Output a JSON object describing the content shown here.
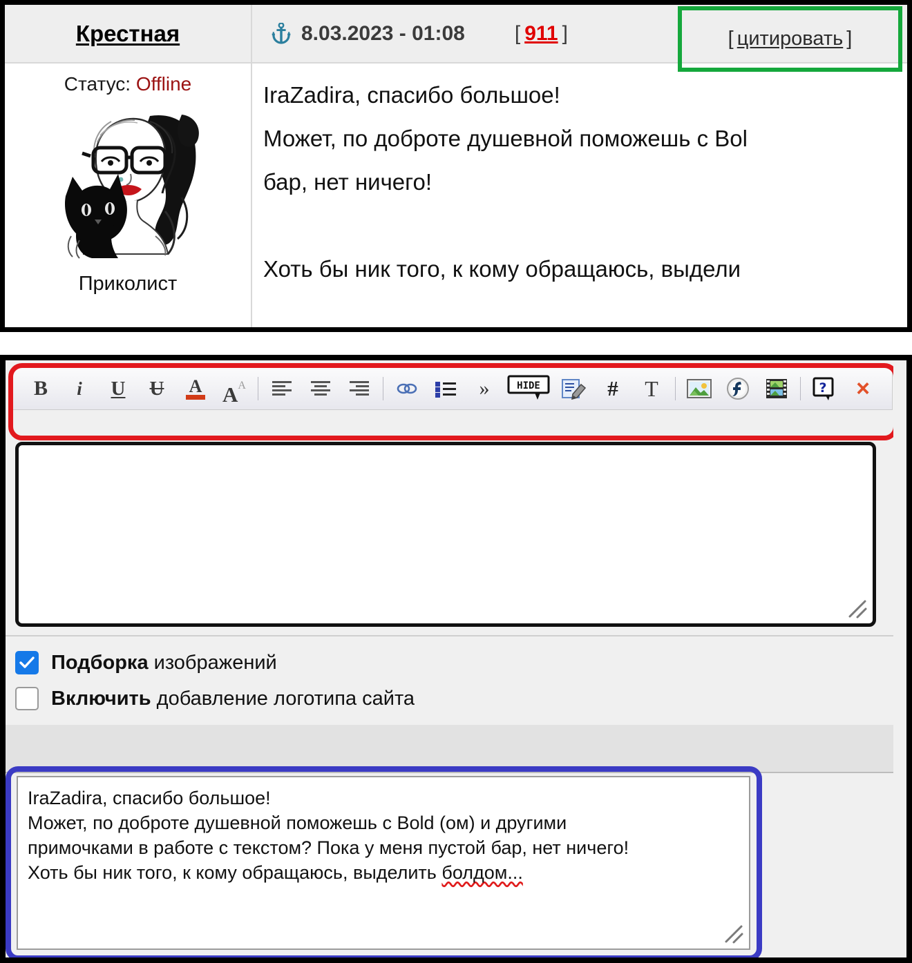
{
  "post": {
    "author": "Крестная",
    "anchor_icon": "anchor-icon",
    "date": "8.03.2023 - 01:08",
    "bracket_open": "[",
    "bracket_close": "]",
    "post_number": "911",
    "quote_label": "цитировать",
    "status_label": "Статус:",
    "status_value": "Offline",
    "rank": "Приколист",
    "avatar_alt": "avatar-woman-with-black-cat",
    "body_lines": [
      "IraZadira, спасибо большое!",
      "Может, по доброте душевной поможешь с Bol",
      "бар, нет ничего!",
      "",
      "Хоть бы ник того, к кому обращаюсь, выдели"
    ]
  },
  "editor": {
    "toolbar": [
      {
        "name": "bold-icon",
        "glyph": "B",
        "title": "Bold"
      },
      {
        "name": "italic-icon",
        "glyph": "i",
        "title": "Italic"
      },
      {
        "name": "underline-icon",
        "glyph": "U",
        "title": "Underline"
      },
      {
        "name": "strikethrough-icon",
        "glyph": "U",
        "title": "Strikethrough"
      },
      {
        "name": "font-color-icon",
        "glyph": "A",
        "title": "Font color"
      },
      {
        "name": "font-size-icon",
        "glyph": "A",
        "title": "Font size"
      },
      {
        "name": "align-left-icon",
        "glyph": "",
        "title": "Align left"
      },
      {
        "name": "align-center-icon",
        "glyph": "",
        "title": "Align center"
      },
      {
        "name": "align-right-icon",
        "glyph": "",
        "title": "Align right"
      },
      {
        "name": "link-icon",
        "glyph": "",
        "title": "Insert link"
      },
      {
        "name": "bullet-list-icon",
        "glyph": "",
        "title": "Bulleted list"
      },
      {
        "name": "quote-icon",
        "glyph": "»",
        "title": "Quote"
      },
      {
        "name": "hide-tag-icon",
        "glyph": "HIDE",
        "title": "Hide tag"
      },
      {
        "name": "edit-note-icon",
        "glyph": "",
        "title": "Edit note"
      },
      {
        "name": "hash-icon",
        "glyph": "#",
        "title": "Code"
      },
      {
        "name": "text-icon",
        "glyph": "T",
        "title": "Plain text"
      },
      {
        "name": "image-icon",
        "glyph": "",
        "title": "Insert image"
      },
      {
        "name": "flash-icon",
        "glyph": "f",
        "title": "Insert flash"
      },
      {
        "name": "video-icon",
        "glyph": "",
        "title": "Insert video"
      },
      {
        "name": "help-icon",
        "glyph": "?",
        "title": "Help"
      },
      {
        "name": "close-icon",
        "glyph": "×",
        "title": "Close"
      }
    ],
    "message_value": "",
    "message_placeholder": "",
    "checkboxes": [
      {
        "name": "selection-of-images",
        "bold": "Подборка",
        "rest": " изображений",
        "checked": true
      },
      {
        "name": "include-site-logo",
        "bold": "Включить",
        "rest": " добавление логотипа сайта",
        "checked": false
      }
    ],
    "quote_lines": [
      "IraZadira, спасибо большое!",
      "Может, по доброте душевной поможешь с Bold (ом) и другими",
      "примочками в работе с текстом? Пока у меня пустой бар, нет ничего!",
      "Хоть бы ник того, к кому обращаюсь, выделить "
    ],
    "quote_misspelled_word": "болдом...",
    "resize_grip": "resize-grip"
  },
  "annotations": {
    "green_box_color": "#15a83c",
    "red_box_color": "#e2191e",
    "blue_box_color": "#3b3bc4"
  }
}
